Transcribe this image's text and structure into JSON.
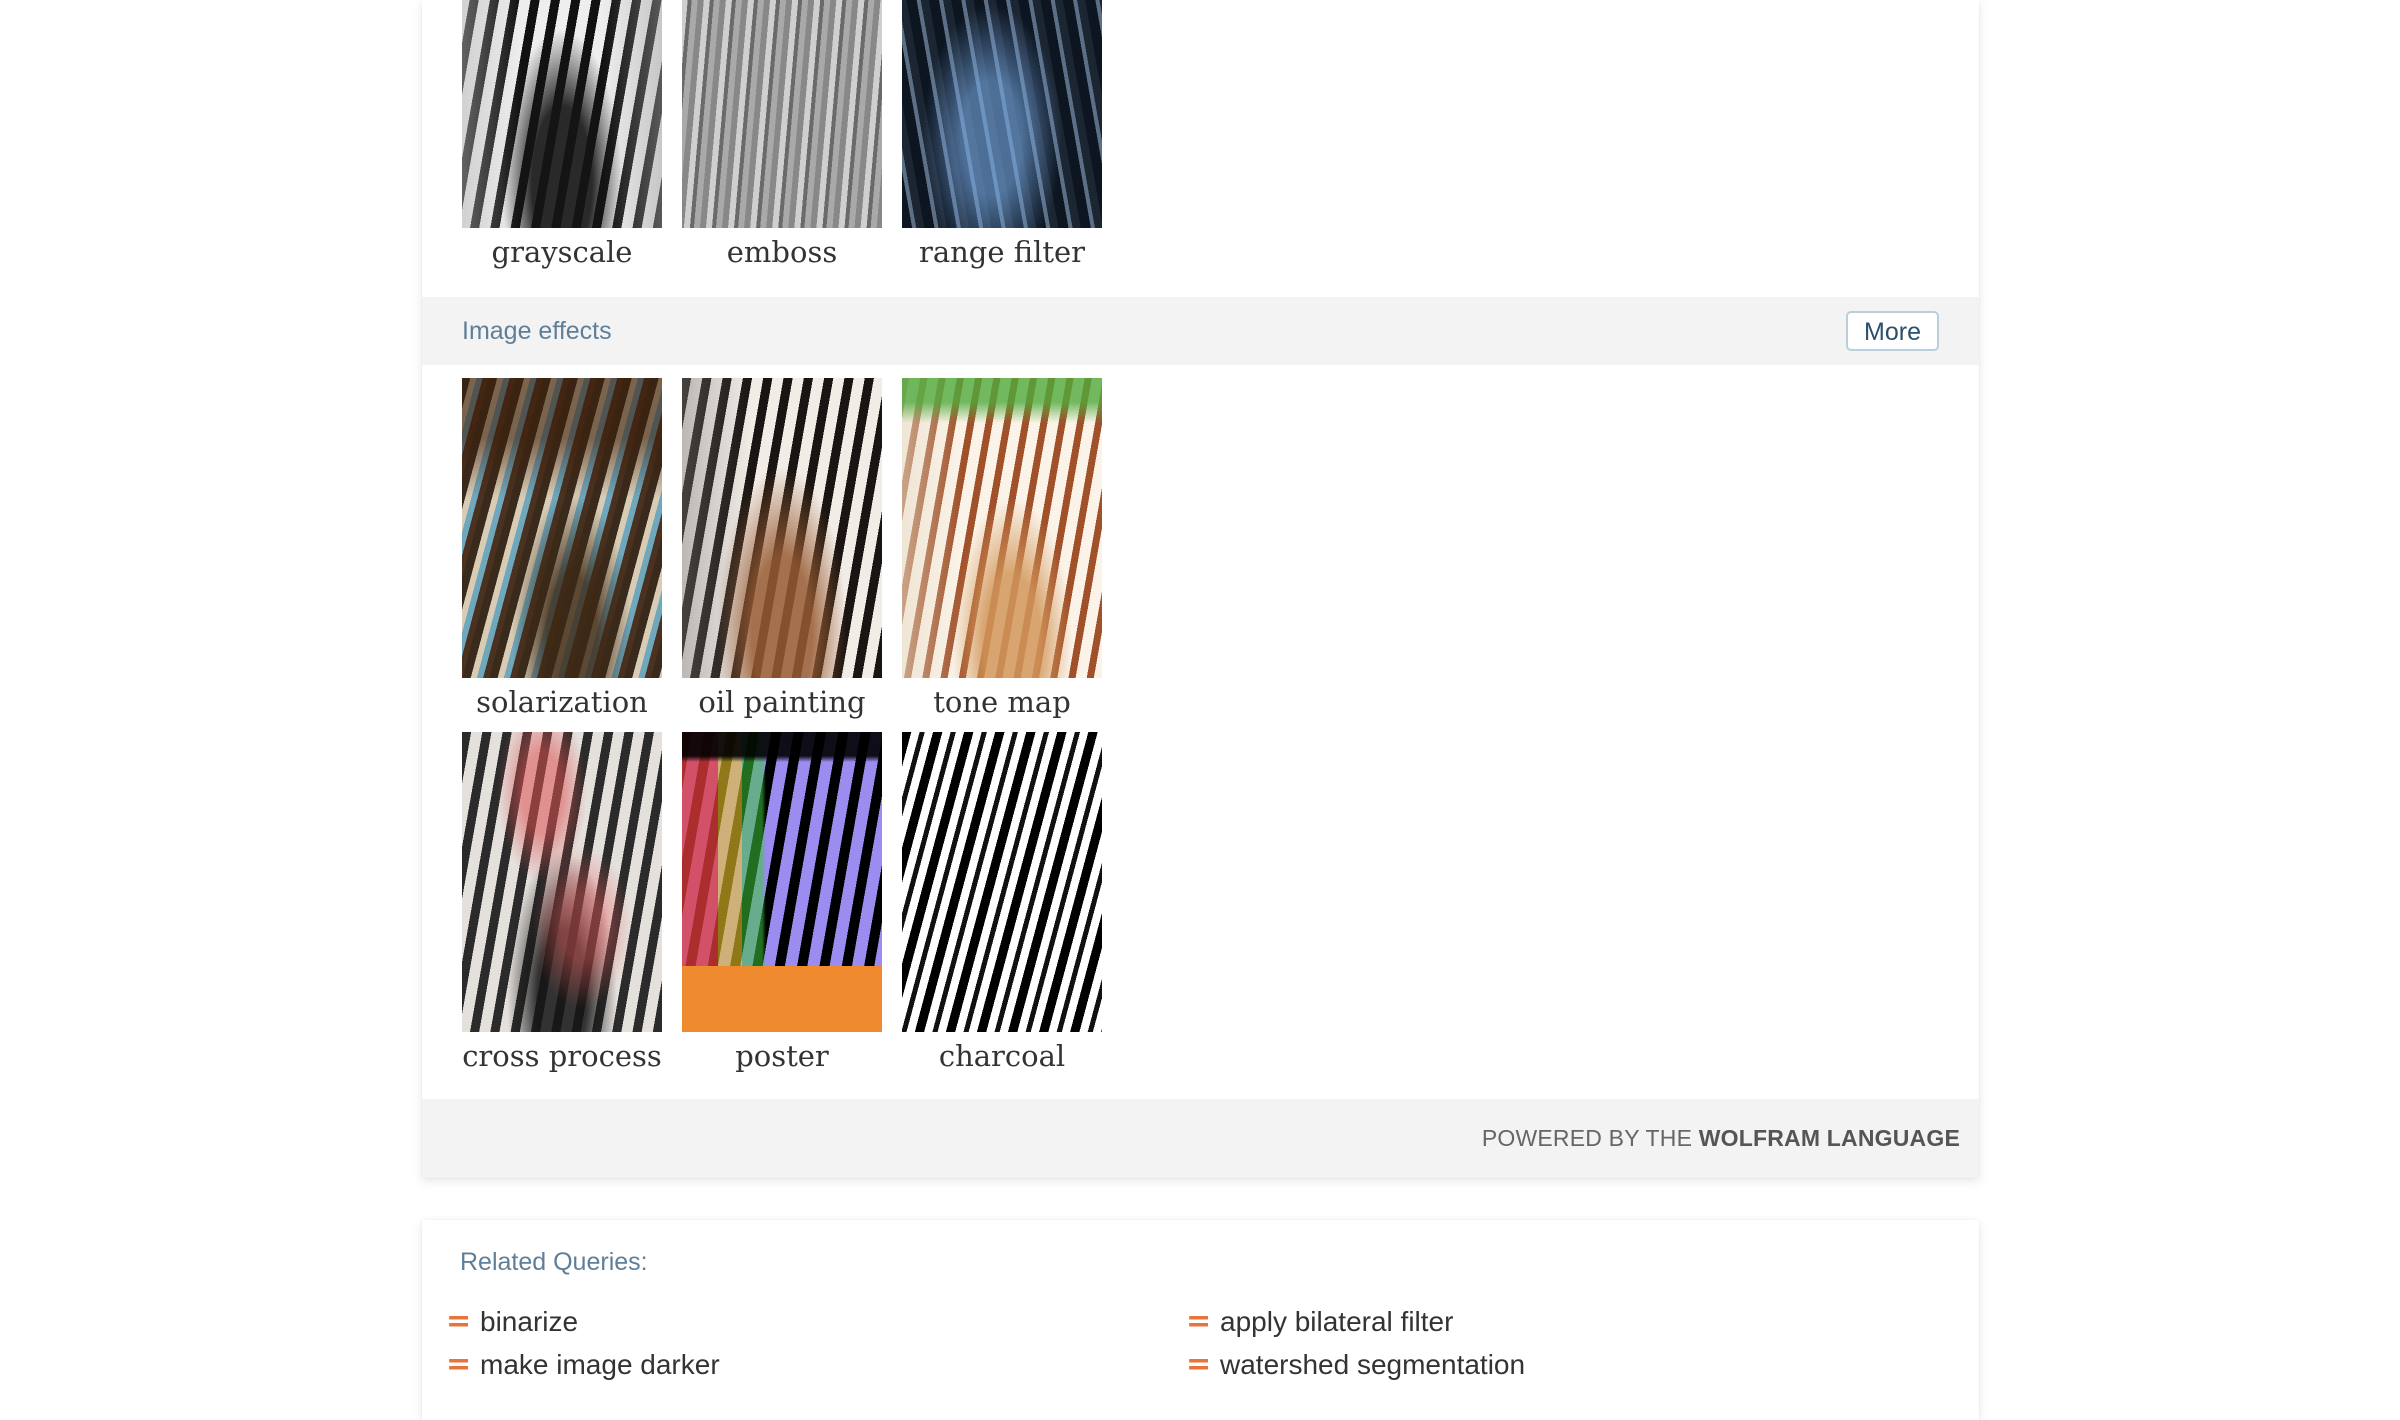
{
  "filters_row": {
    "items": [
      {
        "caption": "grayscale"
      },
      {
        "caption": "emboss"
      },
      {
        "caption": "range filter"
      }
    ]
  },
  "image_effects": {
    "title": "Image effects",
    "more_label": "More",
    "row1": [
      {
        "caption": "solarization"
      },
      {
        "caption": "oil painting"
      },
      {
        "caption": "tone map"
      }
    ],
    "row2": [
      {
        "caption": "cross process"
      },
      {
        "caption": "poster"
      },
      {
        "caption": "charcoal"
      }
    ]
  },
  "footer": {
    "powered_prefix": "POWERED BY THE ",
    "powered_brand": "WOLFRAM LANGUAGE"
  },
  "related": {
    "title": "Related Queries:",
    "left": [
      "binarize",
      "make image darker"
    ],
    "right": [
      "apply bilateral filter",
      "watershed segmentation"
    ],
    "bullet": "="
  },
  "colors": {
    "accent": "#e8743b",
    "section_title": "#5f7f99",
    "bar_bg": "#f3f3f3"
  }
}
